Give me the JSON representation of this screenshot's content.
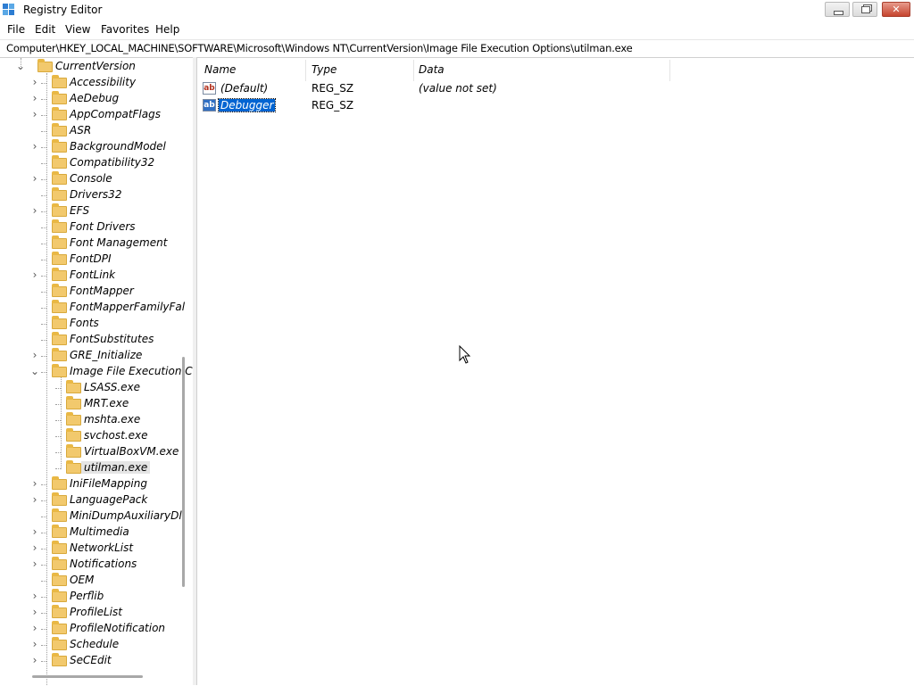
{
  "window": {
    "title": "Registry Editor"
  },
  "menu": [
    "File",
    "Edit",
    "View",
    "Favorites",
    "Help"
  ],
  "address": "Computer\\HKEY_LOCAL_MACHINE\\SOFTWARE\\Microsoft\\Windows NT\\CurrentVersion\\Image File Execution Options\\utilman.exe",
  "tree": [
    {
      "label": "CurrentVersion",
      "level": 0,
      "chevron": "expanded"
    },
    {
      "label": "Accessibility",
      "level": 1,
      "chevron": "collapsed"
    },
    {
      "label": "AeDebug",
      "level": 1,
      "chevron": "collapsed"
    },
    {
      "label": "AppCompatFlags",
      "level": 1,
      "chevron": "collapsed"
    },
    {
      "label": "ASR",
      "level": 1,
      "chevron": "none"
    },
    {
      "label": "BackgroundModel",
      "level": 1,
      "chevron": "collapsed"
    },
    {
      "label": "Compatibility32",
      "level": 1,
      "chevron": "none"
    },
    {
      "label": "Console",
      "level": 1,
      "chevron": "collapsed"
    },
    {
      "label": "Drivers32",
      "level": 1,
      "chevron": "none"
    },
    {
      "label": "EFS",
      "level": 1,
      "chevron": "collapsed"
    },
    {
      "label": "Font Drivers",
      "level": 1,
      "chevron": "none"
    },
    {
      "label": "Font Management",
      "level": 1,
      "chevron": "none"
    },
    {
      "label": "FontDPI",
      "level": 1,
      "chevron": "none"
    },
    {
      "label": "FontLink",
      "level": 1,
      "chevron": "collapsed"
    },
    {
      "label": "FontMapper",
      "level": 1,
      "chevron": "none"
    },
    {
      "label": "FontMapperFamilyFal",
      "level": 1,
      "chevron": "none"
    },
    {
      "label": "Fonts",
      "level": 1,
      "chevron": "none"
    },
    {
      "label": "FontSubstitutes",
      "level": 1,
      "chevron": "none"
    },
    {
      "label": "GRE_Initialize",
      "level": 1,
      "chevron": "collapsed"
    },
    {
      "label": "Image File Execution C",
      "level": 1,
      "chevron": "expanded"
    },
    {
      "label": "LSASS.exe",
      "level": 2,
      "chevron": "none"
    },
    {
      "label": "MRT.exe",
      "level": 2,
      "chevron": "none"
    },
    {
      "label": "mshta.exe",
      "level": 2,
      "chevron": "none"
    },
    {
      "label": "svchost.exe",
      "level": 2,
      "chevron": "none"
    },
    {
      "label": "VirtualBoxVM.exe",
      "level": 2,
      "chevron": "none"
    },
    {
      "label": "utilman.exe",
      "level": 2,
      "chevron": "none",
      "selected": true
    },
    {
      "label": "IniFileMapping",
      "level": 1,
      "chevron": "collapsed"
    },
    {
      "label": "LanguagePack",
      "level": 1,
      "chevron": "collapsed"
    },
    {
      "label": "MiniDumpAuxiliaryDll",
      "level": 1,
      "chevron": "none"
    },
    {
      "label": "Multimedia",
      "level": 1,
      "chevron": "collapsed"
    },
    {
      "label": "NetworkList",
      "level": 1,
      "chevron": "collapsed"
    },
    {
      "label": "Notifications",
      "level": 1,
      "chevron": "collapsed"
    },
    {
      "label": "OEM",
      "level": 1,
      "chevron": "none"
    },
    {
      "label": "Perflib",
      "level": 1,
      "chevron": "collapsed"
    },
    {
      "label": "ProfileList",
      "level": 1,
      "chevron": "collapsed"
    },
    {
      "label": "ProfileNotification",
      "level": 1,
      "chevron": "collapsed"
    },
    {
      "label": "Schedule",
      "level": 1,
      "chevron": "collapsed"
    },
    {
      "label": "SeCEdit",
      "level": 1,
      "chevron": "collapsed"
    }
  ],
  "columns": {
    "name": "Name",
    "type": "Type",
    "data": "Data"
  },
  "values": [
    {
      "name": "(Default)",
      "type": "REG_SZ",
      "data": "(value not set)",
      "icon": "ab",
      "selected": false
    },
    {
      "name": "Debugger",
      "type": "REG_SZ",
      "data": "",
      "icon": "ab",
      "selected": true
    }
  ]
}
